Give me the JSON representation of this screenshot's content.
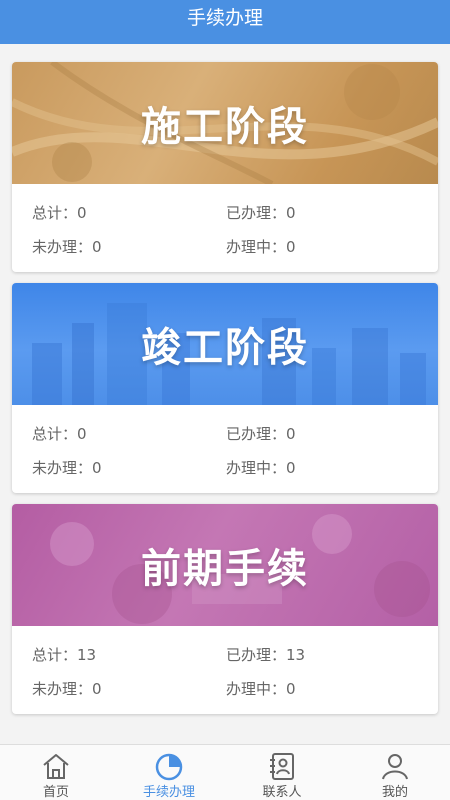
{
  "header": {
    "title": "手续办理"
  },
  "cards": [
    {
      "title": "施工阶段",
      "total": "总计：0",
      "done": "已办理：0",
      "todo": "未办理：0",
      "doing": "办理中：0"
    },
    {
      "title": "竣工阶段",
      "total": "总计：0",
      "done": "已办理：0",
      "todo": "未办理：0",
      "doing": "办理中：0"
    },
    {
      "title": "前期手续",
      "total": "总计：13",
      "done": "已办理：13",
      "todo": "未办理：0",
      "doing": "办理中：0"
    }
  ],
  "tabbar": {
    "items": [
      {
        "label": "首页",
        "icon": "home-icon"
      },
      {
        "label": "手续办理",
        "icon": "procedure-icon"
      },
      {
        "label": "联系人",
        "icon": "contacts-icon"
      },
      {
        "label": "我的",
        "icon": "user-icon"
      }
    ],
    "active_index": 1
  },
  "colors": {
    "accent": "#4a90e2",
    "card1_banner": "#c99a5e",
    "card2_banner": "#4d8fe8",
    "card3_banner": "#b460a6"
  }
}
